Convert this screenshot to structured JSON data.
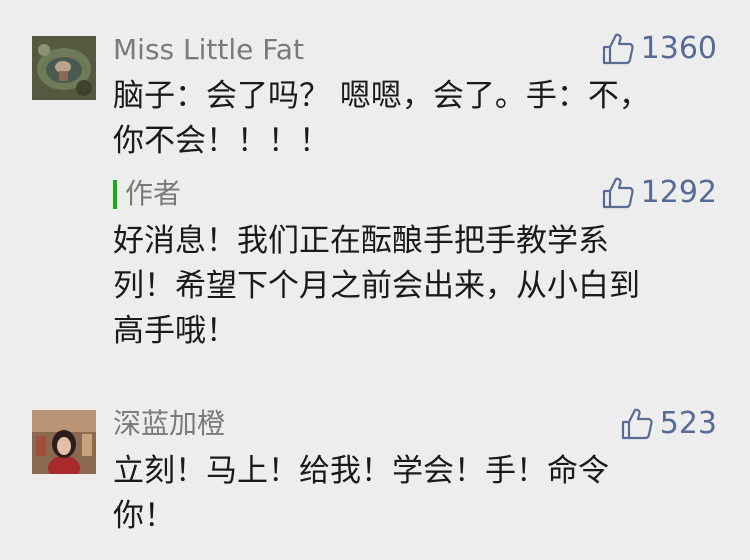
{
  "comments": [
    {
      "username": "Miss Little Fat",
      "likes": "1360",
      "text": "脑子：会了吗？ 嗯嗯，会了。手：不，\n你不会！！！！",
      "reply": {
        "label": "作者",
        "likes": "1292",
        "text": "好消息！我们正在酝酿手把手教学系\n列！希望下个月之前会出来，从小白到\n高手哦！"
      }
    },
    {
      "username": "深蓝加橙",
      "likes": "523",
      "text": "立刻！马上！给我！学会！手！命令\n你！"
    }
  ],
  "colors": {
    "background": "#ededed",
    "link_blue": "#576b95",
    "author_green": "#1aad19",
    "name_gray": "#7a7a7a",
    "text": "#1a1a1a"
  },
  "icons": {
    "like": "thumbs-up-icon"
  }
}
